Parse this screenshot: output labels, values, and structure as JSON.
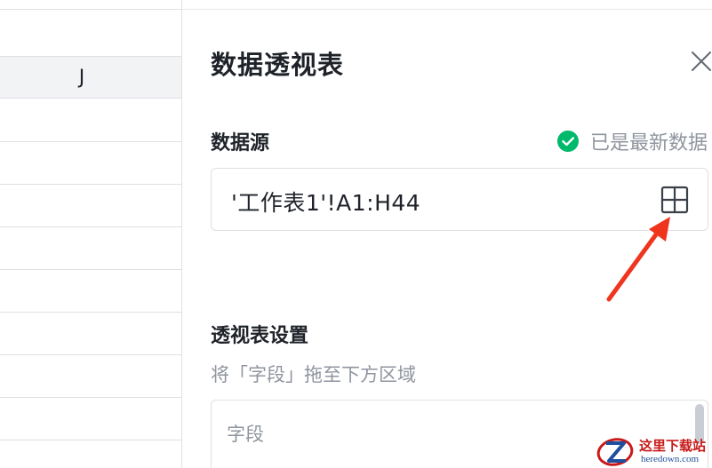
{
  "sheet": {
    "column_header": "J"
  },
  "panel": {
    "title": "数据透视表",
    "close_icon": "close-icon",
    "data_source": {
      "label": "数据源",
      "status_text": "已是最新数据",
      "status_icon": "check-circle-icon",
      "status_color": "#00b96b",
      "value": "'工作表1'!A1:H44",
      "range_icon": "grid-select-icon"
    },
    "pivot_settings": {
      "label": "透视表设置",
      "hint": "将「字段」拖至下方区域",
      "fields_placeholder": "字段"
    }
  },
  "annotation": {
    "arrow_color": "#f0351f"
  },
  "watermark": {
    "title": "这里下载站",
    "subtitle": "heredown.com"
  }
}
